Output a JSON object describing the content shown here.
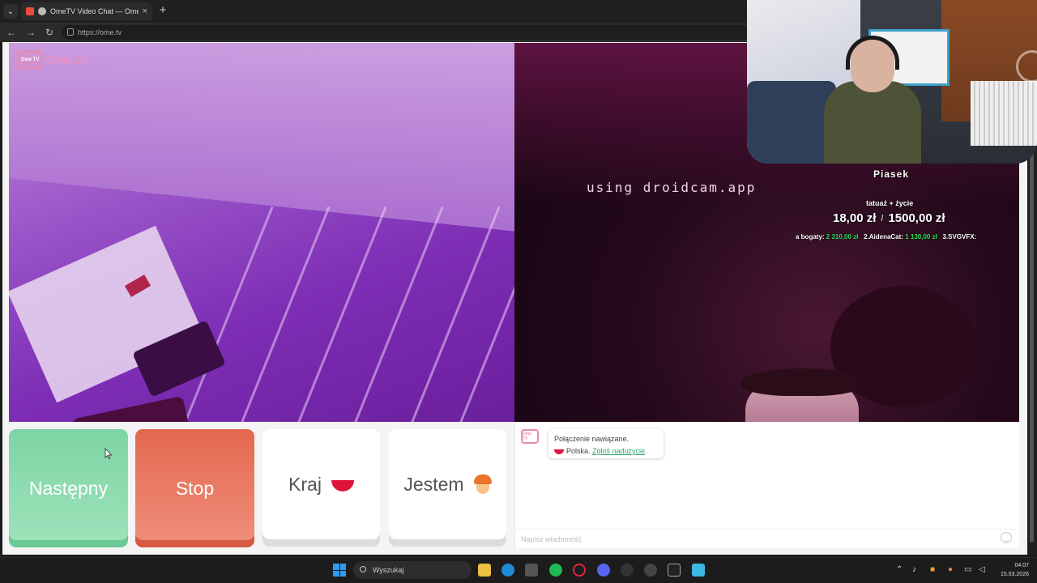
{
  "browser": {
    "tab_title": "OmeTV Video Chat — Omegle",
    "url": "https://ome.tv"
  },
  "site": {
    "logo_text": "Ome.tv",
    "logo_badge": "Ome TV"
  },
  "remote_video": {
    "caption": "using droidcam.app"
  },
  "stream_overlay": {
    "name": "Piasek",
    "goal_label": "tatuaż + życie",
    "goal_current": "18,00 zł",
    "goal_target": "1500,00 zł",
    "ticker": [
      {
        "name": "a bogaty:",
        "amount": "2 310,00 zł"
      },
      {
        "name": "2.AidenaCat:",
        "amount": "1 130,00 zł"
      },
      {
        "name": "3.SVGVFX:",
        "amount": ""
      }
    ]
  },
  "controls": {
    "next_label": "Następny",
    "stop_label": "Stop",
    "country_label": "Kraj",
    "gender_label": "Jestem"
  },
  "chat": {
    "status_line": "Połączenie nawiązane.",
    "country": "Polska.",
    "report_link": "Zgłoś nadużycie",
    "report_suffix": ".",
    "input_placeholder": "Napisz wiadomość"
  },
  "taskbar": {
    "search_placeholder": "Wyszukaj",
    "time": "04:07",
    "date": "15.03.2026"
  },
  "colors": {
    "next_button": "#7ed4a4",
    "stop_button": "#e3684f",
    "flag_red": "#dc143c",
    "ticker_amount": "#27e05a"
  }
}
